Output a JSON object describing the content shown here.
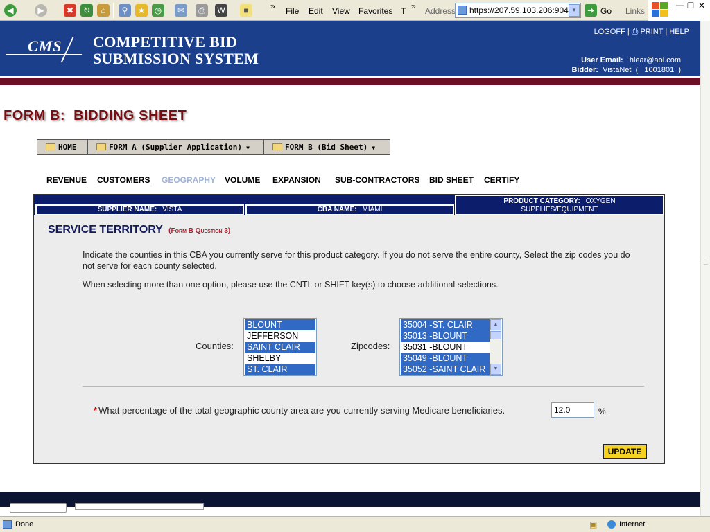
{
  "browser": {
    "menu": [
      "File",
      "Edit",
      "View",
      "Favorites",
      "T"
    ],
    "address_label": "Address",
    "address_url": "https://207.59.103.206:9045",
    "go_label": "Go",
    "links_label": "Links",
    "status_text": "Done",
    "zone_text": "Internet"
  },
  "header": {
    "logo_text": "CMS",
    "title_line1": "COMPETITIVE BID",
    "title_line2": "SUBMISSION SYSTEM",
    "links": {
      "logoff": "LOGOFF",
      "print": "PRINT",
      "help": "HELP"
    },
    "user_email_label": "User Email:",
    "user_email": "hlear@aol.com",
    "bidder_label": "Bidder:",
    "bidder_value": "VistaNet  (   1001801  )"
  },
  "page": {
    "title": "FORM B:  BIDDING SHEET"
  },
  "nav_buttons": [
    {
      "label": "HOME",
      "has_menu": false
    },
    {
      "label": "FORM A (Supplier Application)",
      "has_menu": true
    },
    {
      "label": "FORM B (Bid Sheet)",
      "has_menu": true
    }
  ],
  "tabs": [
    {
      "label": "REVENUE",
      "active": true
    },
    {
      "label": "CUSTOMERS",
      "active": true
    },
    {
      "label": "GEOGRAPHY",
      "active": false
    },
    {
      "label": "VOLUME",
      "active": true
    },
    {
      "label": "EXPANSION",
      "active": true
    },
    {
      "label": "SUB-CONTRACTORS",
      "active": true
    },
    {
      "label": "BID SHEET",
      "active": true
    },
    {
      "label": "CERTIFY",
      "active": true
    }
  ],
  "info_bar": {
    "supplier_label": "SUPPLIER NAME:",
    "supplier_value": "VISTA",
    "cba_label": "CBA NAME:",
    "cba_value": "MIAMI",
    "category_label": "PRODUCT CATEGORY:",
    "category_value_line1": "OXYGEN",
    "category_value_line2": "SUPPLIES/EQUIPMENT"
  },
  "section": {
    "title": "SERVICE TERRITORY",
    "subtitle": "(Form B Question 3)",
    "para1": "Indicate the counties in this CBA you currently serve for this product category. If you do not serve the entire county, Select the zip codes you do not serve for each county selected.",
    "para2": "When selecting more than one option, please use the CNTL or SHIFT key(s) to choose additional selections."
  },
  "counties": {
    "label": "Counties:",
    "options": [
      {
        "text": "BLOUNT",
        "selected": true
      },
      {
        "text": "JEFFERSON",
        "selected": false
      },
      {
        "text": "SAINT CLAIR",
        "selected": true
      },
      {
        "text": "SHELBY",
        "selected": false
      },
      {
        "text": "ST. CLAIR",
        "selected": true
      }
    ]
  },
  "zipcodes": {
    "label": "Zipcodes:",
    "options": [
      {
        "text": "35004 -ST. CLAIR",
        "selected": true
      },
      {
        "text": "35013 -BLOUNT",
        "selected": true
      },
      {
        "text": "35031 -BLOUNT",
        "selected": false
      },
      {
        "text": "35049 -BLOUNT",
        "selected": true
      },
      {
        "text": "35052 -SAINT CLAIR",
        "selected": true
      }
    ]
  },
  "question": {
    "required_mark": "*",
    "text": "What percentage of the total geographic county area are you currently serving Medicare beneficiaries.",
    "value": "12.0",
    "unit": "%"
  },
  "actions": {
    "update_label": "UPDATE"
  },
  "colors": {
    "banner": "#1c3f8c",
    "accent_strip": "#6b0f27",
    "title": "#7a0d12",
    "selection": "#316ac5",
    "update_button": "#f4d21f"
  }
}
